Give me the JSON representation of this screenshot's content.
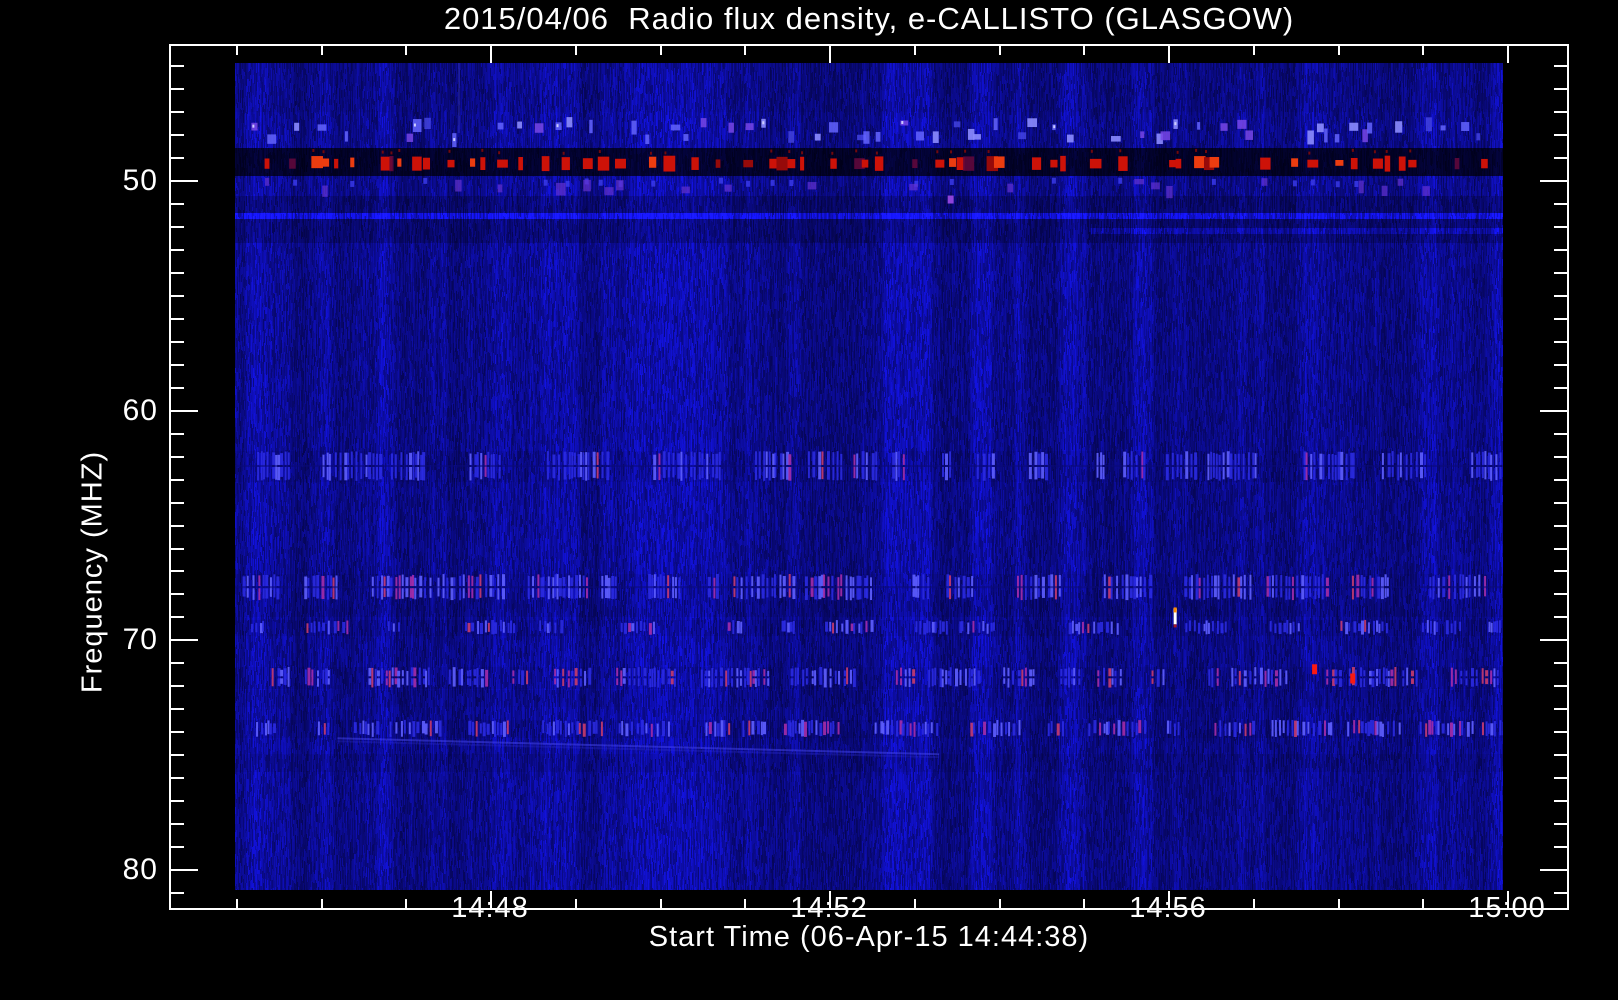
{
  "title": "2015/04/06  Radio flux density, e-CALLISTO (GLASGOW)",
  "chart_data": {
    "type": "heatmap",
    "title": "2015/04/06  Radio flux density, e-CALLISTO (GLASGOW)",
    "xlabel": "Start Time (06-Apr-15 14:44:38)",
    "ylabel": "Frequency (MHZ)",
    "x_tick_labels": [
      "14:48",
      "14:52",
      "14:56",
      "15:00"
    ],
    "y_tick_labels": [
      "50",
      "60",
      "70",
      "80"
    ],
    "x_range": [
      "14:45",
      "15:00"
    ],
    "x_minor_step_min": 1,
    "y_range_mhz": [
      45,
      81
    ],
    "y_axis_span_mhz": [
      44.1,
      81.7
    ],
    "y_minor_step_mhz": 1,
    "y_inverted": true,
    "grid": "off",
    "legend": "none",
    "instrument": "e-CALLISTO",
    "station": "GLASGOW",
    "date": "2015/04/06",
    "start_time": "14:44:38",
    "colors": {
      "background": "#000000",
      "plot_base": "#0b0b96",
      "frame": "#ffffff",
      "text": "#ffffff",
      "burst_red": "#cd1208",
      "burst_orange": "#ec3c10",
      "speckle_blue": "#8c8cff",
      "stripe_blue": "#4646e6",
      "stripe_magenta": "#a52da8",
      "stripe_pink": "#c83c6e",
      "saturated_white": "#ffffff",
      "saturated_orange": "#ff8c00",
      "purple": "#8c46dc"
    },
    "bands": [
      {
        "freq_low_mhz": 47.3,
        "freq_high_mhz": 48.6,
        "style": "speckle-blobs",
        "label": "intermittent blue/purple burst blobs"
      },
      {
        "freq_low_mhz": 48.6,
        "freq_high_mhz": 49.8,
        "style": "dark-band-red-bursts",
        "label": "dark RFI channel with saturated red bursts"
      },
      {
        "freq_low_mhz": 49.9,
        "freq_high_mhz": 50.5,
        "style": "purple-blobs",
        "label": "weak purple burst echoes"
      },
      {
        "freq_low_mhz": 50.7,
        "freq_high_mhz": 52.7,
        "style": "dim-belt",
        "label": "slightly darker quiet belt"
      },
      {
        "freq_low_mhz": 51.45,
        "freq_high_mhz": 51.65,
        "style": "faint-bright-line",
        "label": "faint continuous carrier line"
      },
      {
        "freq_low_mhz": 61.8,
        "freq_high_mhz": 63.1,
        "style": "blue-stripes",
        "label": "dense pulsed blue RFI stripes"
      },
      {
        "freq_low_mhz": 67.15,
        "freq_high_mhz": 68.3,
        "style": "magenta-stripes",
        "label": "pulsed stripes with magenta tips"
      },
      {
        "freq_low_mhz": 69.15,
        "freq_high_mhz": 69.8,
        "style": "blue-stripes-sparse",
        "label": "sparser pulsed stripes"
      },
      {
        "freq_low_mhz": 71.2,
        "freq_high_mhz": 72.1,
        "style": "magenta-stripes",
        "rare_red": true,
        "label": "pulsed stripes, occasional red"
      },
      {
        "freq_low_mhz": 73.5,
        "freq_high_mhz": 74.25,
        "style": "magenta-stripes",
        "label": "pulsed stripes with magenta tips"
      }
    ],
    "features": [
      {
        "type": "bright-point",
        "time": "14:53:24",
        "freq_mhz": 50.85,
        "color": "purple",
        "label": "isolated purple pixel"
      },
      {
        "type": "bright-point",
        "time": "14:56:04",
        "freq_mhz": 69.0,
        "color": "white-orange",
        "label": "saturated white/orange dash"
      },
      {
        "type": "bright-point",
        "time": "14:57:42",
        "freq_mhz": 71.3,
        "color": "red",
        "label": "bright red spot"
      },
      {
        "type": "bright-point",
        "time": "14:58:09",
        "freq_mhz": 71.7,
        "color": "red",
        "label": "bright red spot"
      },
      {
        "type": "drift-line",
        "time_start": "14:46:12",
        "time_end": "14:53:18",
        "freq_start_mhz": 74.3,
        "freq_end_mhz": 75.0,
        "label": "faint slowly drifting edge"
      }
    ]
  }
}
